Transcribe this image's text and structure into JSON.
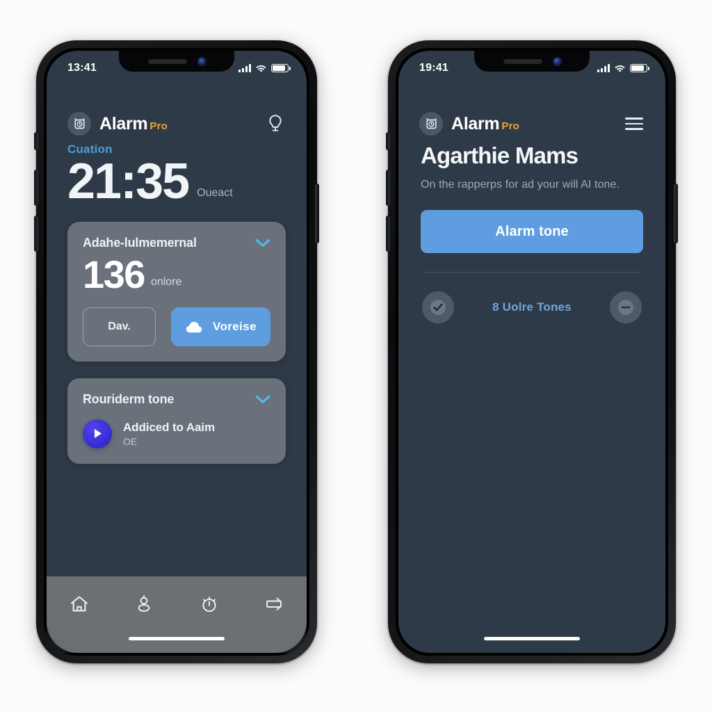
{
  "background_color": "#fbfbfb",
  "accent_blue": "#5d9de0",
  "accent_orange": "#e8a33d",
  "screen_bg": "#2e3a47",
  "card_bg": "#6a717a",
  "phones": {
    "left": {
      "status_bar": {
        "time": "13:41",
        "signal": "signal-bars",
        "wifi": "wifi",
        "battery": "battery-full"
      },
      "header": {
        "brand_name": "Alarm",
        "brand_suffix": "Pro",
        "badge_icon": "alarm-clock-icon",
        "action_icon": "lightbulb-icon"
      },
      "hero": {
        "kicker": "Cuation",
        "time": "21:35",
        "time_suffix": "Oueact"
      },
      "cards": [
        {
          "title": "Adahe-lulmemernal",
          "chevron": "chevron-down-icon",
          "metric": "136",
          "metric_sub": "onlore",
          "buttons": {
            "secondary": "Dav.",
            "primary": "Voreise",
            "primary_icon": "cloud-icon"
          }
        },
        {
          "title": "Rouriderm tone",
          "chevron": "chevron-down-icon",
          "track": {
            "play_icon": "play-icon",
            "title": "Addiced to Aaim",
            "subtitle": "OE"
          }
        }
      ],
      "tabbar": {
        "items": [
          {
            "icon": "home-icon",
            "name": "tab-home"
          },
          {
            "icon": "location-pin-icon",
            "name": "tab-location"
          },
          {
            "icon": "stopwatch-icon",
            "name": "tab-timer"
          },
          {
            "icon": "speaker-flag-icon",
            "name": "tab-sound"
          }
        ]
      }
    },
    "right": {
      "status_bar": {
        "time": "19:41",
        "signal": "signal-bars",
        "wifi": "wifi",
        "battery": "battery-full"
      },
      "header": {
        "brand_name": "Alarm",
        "brand_suffix": "Pro",
        "badge_icon": "alarm-clock-icon",
        "action_icon": "hamburger-menu-icon"
      },
      "page": {
        "title": "Agarthie Mams",
        "subtitle": "On the rapperps for ad your will AI tone.",
        "cta_label": "Alarm tone",
        "list_row": {
          "left_icon": "check-circle-icon",
          "label": "8 Uolre Tones",
          "right_icon": "minus-circle-icon"
        }
      }
    }
  }
}
